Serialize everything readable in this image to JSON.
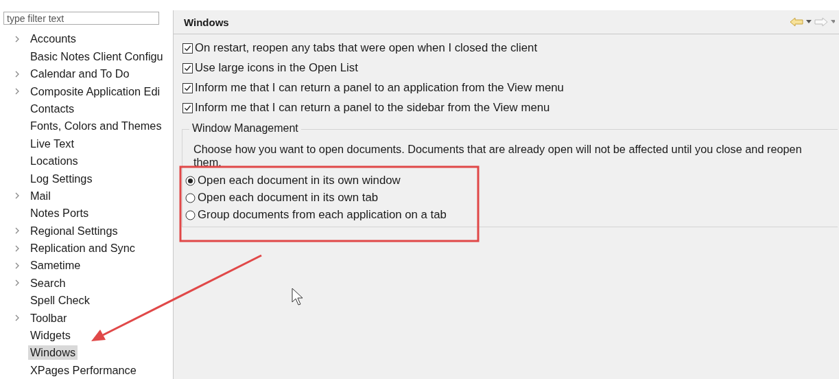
{
  "filter": {
    "placeholder": "type filter text"
  },
  "sidebar": {
    "items": [
      {
        "label": "Accounts",
        "expandable": true,
        "selected": false
      },
      {
        "label": "Basic Notes Client Configu",
        "expandable": false,
        "selected": false
      },
      {
        "label": "Calendar and To Do",
        "expandable": true,
        "selected": false
      },
      {
        "label": "Composite Application Edi",
        "expandable": true,
        "selected": false
      },
      {
        "label": "Contacts",
        "expandable": false,
        "selected": false
      },
      {
        "label": "Fonts, Colors and Themes",
        "expandable": false,
        "selected": false
      },
      {
        "label": "Live Text",
        "expandable": false,
        "selected": false
      },
      {
        "label": "Locations",
        "expandable": false,
        "selected": false
      },
      {
        "label": "Log Settings",
        "expandable": false,
        "selected": false
      },
      {
        "label": "Mail",
        "expandable": true,
        "selected": false
      },
      {
        "label": "Notes Ports",
        "expandable": false,
        "selected": false
      },
      {
        "label": "Regional Settings",
        "expandable": true,
        "selected": false
      },
      {
        "label": "Replication and Sync",
        "expandable": true,
        "selected": false
      },
      {
        "label": "Sametime",
        "expandable": true,
        "selected": false
      },
      {
        "label": "Search",
        "expandable": true,
        "selected": false
      },
      {
        "label": "Spell Check",
        "expandable": false,
        "selected": false
      },
      {
        "label": "Toolbar",
        "expandable": true,
        "selected": false
      },
      {
        "label": "Widgets",
        "expandable": false,
        "selected": false
      },
      {
        "label": "Windows",
        "expandable": false,
        "selected": true
      },
      {
        "label": "XPages Performance",
        "expandable": false,
        "selected": false
      }
    ]
  },
  "page": {
    "title": "Windows",
    "options": [
      {
        "label": "On restart, reopen any tabs that were open when I closed the client",
        "checked": true
      },
      {
        "label": "Use large icons in the Open List",
        "checked": true
      },
      {
        "label": "Inform me that I can return a panel to an application from the View menu",
        "checked": true
      },
      {
        "label": "Inform me that I can return a panel to the sidebar from the View menu",
        "checked": true
      }
    ],
    "group": {
      "title": "Window Management",
      "description": "Choose how you want to open documents.  Documents that are already open will not be affected until you close and reopen them.",
      "choices": [
        {
          "label": "Open each document in its own window",
          "selected": true
        },
        {
          "label": "Open each document in its own tab",
          "selected": false
        },
        {
          "label": "Group documents from each application on a tab",
          "selected": false
        }
      ]
    }
  }
}
